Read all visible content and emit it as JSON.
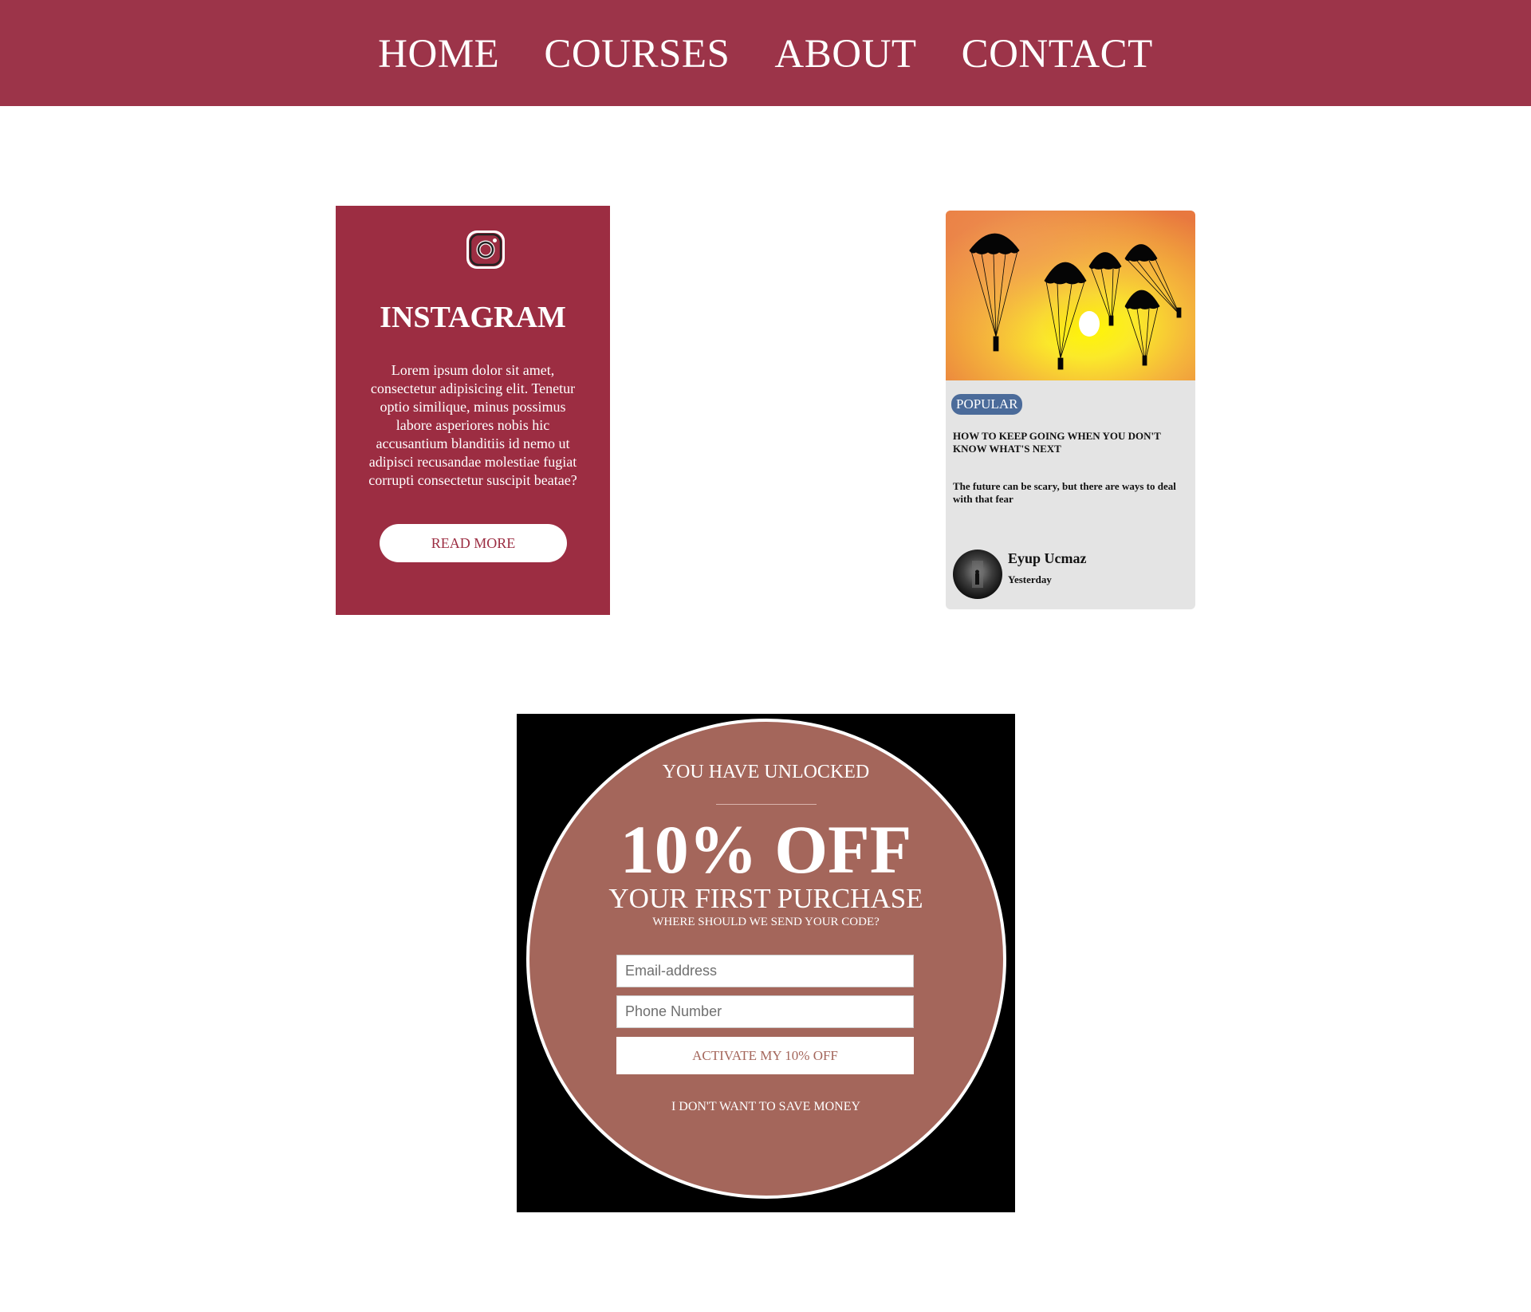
{
  "nav": {
    "items": [
      "HOME",
      "COURSES",
      "ABOUT",
      "CONTACT"
    ]
  },
  "instagram_card": {
    "icon": "instagram-icon",
    "title": "INSTAGRAM",
    "body": "Lorem ipsum dolor sit amet, consectetur adipisicing elit. Tenetur optio similique, minus possimus labore asperiores nobis hic accusantium blanditiis id nemo ut adipisci recusandae molestiae fugiat corrupti consectetur suscipit beatae?",
    "button_label": "READ MORE",
    "colors": {
      "background": "#9c2d42",
      "button_text": "#9c2d42"
    }
  },
  "blog_card": {
    "image": "parachutes-sunset-image",
    "tag": "POPULAR",
    "title": "HOW TO KEEP GOING WHEN YOU DON'T KNOW WHAT'S NEXT",
    "description": "The future can be scary, but there are ways to deal with that fear",
    "author": "Eyup Ucmaz",
    "date": "Yesterday",
    "colors": {
      "tag": "#4b6b9a",
      "card": "#e4e4e4"
    }
  },
  "promo": {
    "unlocked": "YOU HAVE UNLOCKED",
    "discount": "10% OFF",
    "subtitle": "YOUR FIRST PURCHASE",
    "question": "WHERE SHOULD WE SEND YOUR CODE?",
    "email_placeholder": "Email-address",
    "phone_placeholder": "Phone Number",
    "activate_label": "ACTIVATE MY 10% OFF",
    "decline_label": "I DON'T WANT TO SAVE MONEY",
    "colors": {
      "circle": "#a4665b",
      "background": "#000000"
    }
  },
  "colors": {
    "nav_background": "#9c3449"
  }
}
